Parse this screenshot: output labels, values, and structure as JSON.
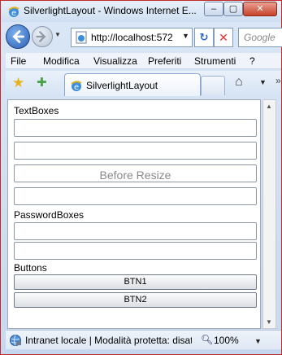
{
  "window": {
    "title": "SilverlightLayout - Windows Internet E...",
    "min_glyph": "–",
    "max_glyph": "▢",
    "close_glyph": "✕"
  },
  "address": {
    "url": "http://localhost:572",
    "dropdown_glyph": "▼",
    "refresh_glyph": "↻",
    "stop_glyph": "✕"
  },
  "search": {
    "placeholder": "Google"
  },
  "menu": {
    "items": [
      "File",
      "Modifica",
      "Visualizza",
      "Preferiti",
      "Strumenti",
      "?"
    ]
  },
  "tabs": {
    "active_label": "SilverlightLayout"
  },
  "toolbar": {
    "home_drop_glyph": "▼",
    "tools_glyph": "»"
  },
  "content": {
    "textboxes_label": "TextBoxes",
    "textbox_values": [
      "",
      "",
      "Before Resize",
      ""
    ],
    "passwordboxes_label": "PasswordBoxes",
    "buttons_label": "Buttons",
    "button_labels": [
      "BTN1",
      "BTN2"
    ]
  },
  "scrollbar": {
    "up_glyph": "▲",
    "down_glyph": "▼"
  },
  "status": {
    "zone_text": "Intranet locale | Modalità protetta: disat",
    "zoom": "100%",
    "zoom_drop_glyph": "▼"
  },
  "icons": {
    "ie": "ie-icon",
    "back": "back-arrow-icon",
    "forward": "forward-arrow-icon",
    "favorites": "star-icon",
    "add_favorites": "add-favorites-icon",
    "home": "home-icon",
    "globe": "intranet-globe-icon",
    "zoom": "magnifier-icon"
  },
  "colors": {
    "window_frame": "#c02a2a",
    "chrome_bg": "#c6d8ef",
    "close_button": "#c8432b",
    "back_button": "#2a5fb5"
  }
}
